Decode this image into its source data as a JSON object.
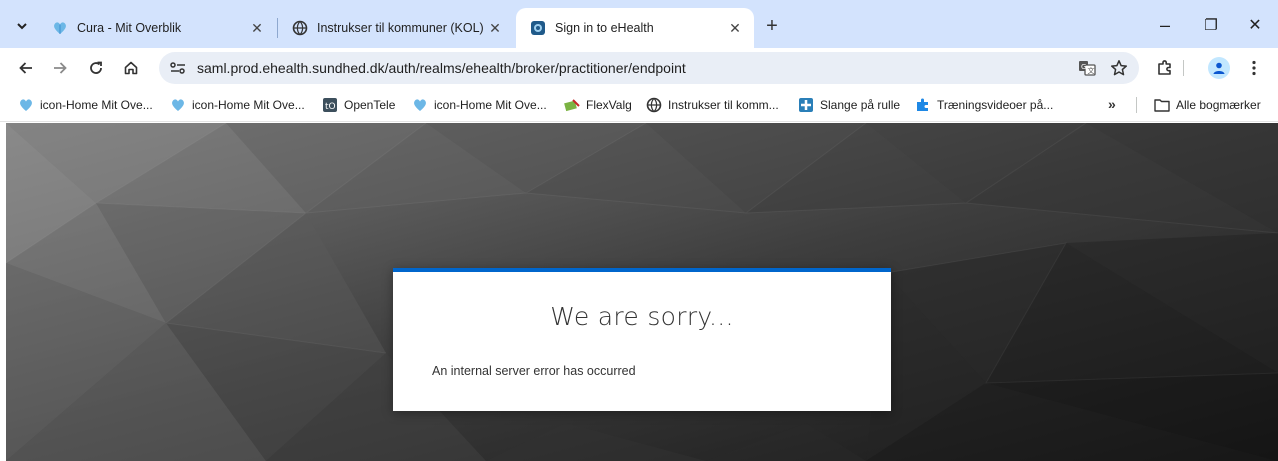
{
  "browser": {
    "tabs": [
      {
        "title": "Cura - Mit Overblik",
        "favicon": "heart-favicon",
        "active": false
      },
      {
        "title": "Instrukser til kommuner (KOL)",
        "favicon": "globe-icon",
        "active": false
      },
      {
        "title": "Sign in to eHealth",
        "favicon": "ehealth-favicon",
        "active": true
      }
    ],
    "new_tab_symbol": "+",
    "close_symbol": "✕",
    "window_controls": {
      "minimize": "–",
      "restore": "❐",
      "close": "✕"
    }
  },
  "toolbar": {
    "url": "saml.prod.ehealth.sundhed.dk/auth/realms/ehealth/broker/practitioner/endpoint"
  },
  "bookmarks": {
    "items": [
      {
        "label": "icon-Home Mit Ove...",
        "icon": "heart-favicon"
      },
      {
        "label": "icon-Home Mit Ove...",
        "icon": "heart-favicon"
      },
      {
        "label": "OpenTele",
        "icon": "opentele-icon"
      },
      {
        "label": "icon-Home Mit Ove...",
        "icon": "heart-favicon"
      },
      {
        "label": "FlexValg",
        "icon": "flexvalg-icon"
      },
      {
        "label": "Instrukser til komm...",
        "icon": "globe-icon"
      },
      {
        "label": "Slange på rulle",
        "icon": "slange-icon"
      },
      {
        "label": "Træningsvideoer på...",
        "icon": "puzzle-icon"
      }
    ],
    "more_symbol": "»",
    "all_bookmarks_label": "Alle bogmærker"
  },
  "page": {
    "title": "We are sorry...",
    "message": "An internal server error has occurred",
    "accent_color": "#0066cc"
  }
}
